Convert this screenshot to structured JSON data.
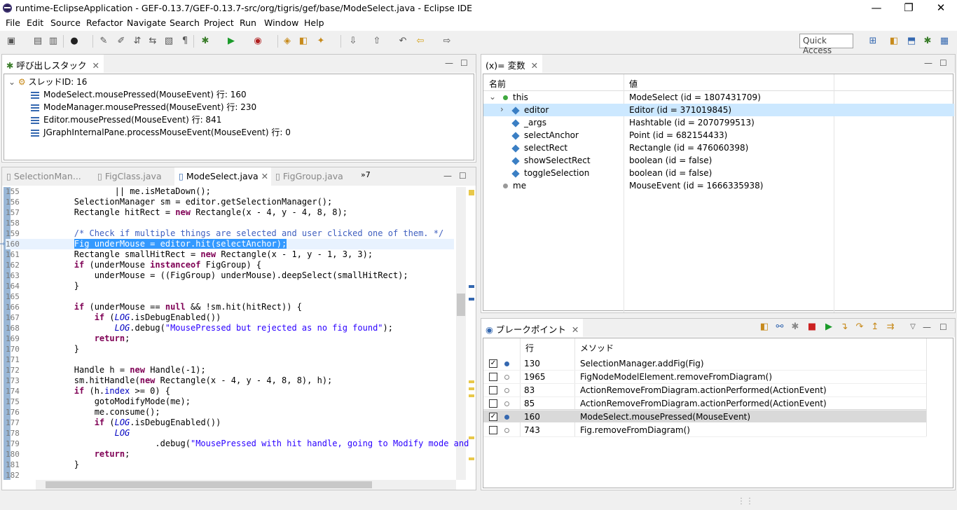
{
  "window": {
    "title": "runtime-EclipseApplication - GEF-0.13.7/GEF-0.13.7-src/org/tigris/gef/base/ModeSelect.java - Eclipse IDE",
    "minimize": "—",
    "restore": "❐",
    "close": "✕"
  },
  "menu": [
    {
      "label": "File"
    },
    {
      "label": "Edit"
    },
    {
      "label": "Source"
    },
    {
      "label": "Refactor"
    },
    {
      "label": "Navigate"
    },
    {
      "label": "Search"
    },
    {
      "label": "Project"
    },
    {
      "label": "Run"
    },
    {
      "label": "Window"
    },
    {
      "label": "Help"
    }
  ],
  "toolbar": {
    "quick_access": "Quick Access"
  },
  "callstack": {
    "tab": "呼び出しスタック",
    "thread": "スレッドID: 16",
    "frames": [
      "ModeSelect.mousePressed(MouseEvent) 行: 160",
      "ModeManager.mousePressed(MouseEvent) 行: 230",
      "Editor.mousePressed(MouseEvent) 行: 841",
      "JGraphInternalPane.processMouseEvent(MouseEvent) 行: 0"
    ]
  },
  "editor": {
    "tabs": [
      "SelectionMan...",
      "FigClass.java",
      "ModeSelect.java",
      "FigGroup.java"
    ],
    "overflow": "»7",
    "active_tab": 2
  },
  "variables": {
    "tab": "(x)= 変数",
    "col_name": "名前",
    "col_value": "値",
    "rows": [
      {
        "name": "this",
        "value": "ModeSelect (id = 1807431709)"
      },
      {
        "name": "editor",
        "value": "Editor (id = 371019845)"
      },
      {
        "name": "_args",
        "value": "Hashtable (id = 2070799513)"
      },
      {
        "name": "selectAnchor",
        "value": "Point (id = 682154433)"
      },
      {
        "name": "selectRect",
        "value": "Rectangle (id = 476060398)"
      },
      {
        "name": "showSelectRect",
        "value": "boolean (id = false)"
      },
      {
        "name": "toggleSelection",
        "value": "boolean (id = false)"
      },
      {
        "name": "me",
        "value": "MouseEvent (id = 1666335938)"
      }
    ]
  },
  "breakpoints": {
    "tab": "ブレークポイント",
    "col_line": "行",
    "col_method": "メソッド",
    "rows": [
      {
        "line": "130",
        "method": "SelectionManager.addFig(Fig)",
        "checked": "✓"
      },
      {
        "line": "1965",
        "method": "FigNodeModelElement.removeFromDiagram()",
        "checked": ""
      },
      {
        "line": "83",
        "method": "ActionRemoveFromDiagram.actionPerformed(ActionEvent)",
        "checked": ""
      },
      {
        "line": "85",
        "method": "ActionRemoveFromDiagram.actionPerformed(ActionEvent)",
        "checked": ""
      },
      {
        "line": "160",
        "method": "ModeSelect.mousePressed(MouseEvent)",
        "checked": "✓"
      },
      {
        "line": "743",
        "method": "Fig.removeFromDiagram()",
        "checked": ""
      }
    ]
  },
  "code_lines": [
    {
      "n": "155",
      "t": "                || me.isMetaDown();"
    },
    {
      "n": "156",
      "t": "        SelectionManager sm = editor.getSelectionManager();"
    },
    {
      "n": "157",
      "t": "        Rectangle hitRect = new Rectangle(x - 4, y - 4, 8, 8);"
    },
    {
      "n": "158",
      "t": ""
    },
    {
      "n": "159",
      "t": "        /* Check if multiple things are selected and user clicked one of them. */"
    },
    {
      "n": "160",
      "t": "        Fig underMouse = editor.hit(selectAnchor);"
    },
    {
      "n": "161",
      "t": "        Rectangle smallHitRect = new Rectangle(x - 1, y - 1, 3, 3);"
    },
    {
      "n": "162",
      "t": "        if (underMouse instanceof FigGroup) {"
    },
    {
      "n": "163",
      "t": "            underMouse = ((FigGroup) underMouse).deepSelect(smallHitRect);"
    },
    {
      "n": "164",
      "t": "        }"
    },
    {
      "n": "165",
      "t": ""
    },
    {
      "n": "166",
      "t": "        if (underMouse == null && !sm.hit(hitRect)) {"
    },
    {
      "n": "167",
      "t": "            if (LOG.isDebugEnabled())"
    },
    {
      "n": "168",
      "t": "                LOG.debug(\"MousePressed but rejected as no fig found\");"
    },
    {
      "n": "169",
      "t": "            return;"
    },
    {
      "n": "170",
      "t": "        }"
    },
    {
      "n": "171",
      "t": ""
    },
    {
      "n": "172",
      "t": "        Handle h = new Handle(-1);"
    },
    {
      "n": "173",
      "t": "        sm.hitHandle(new Rectangle(x - 4, y - 4, 8, 8), h);"
    },
    {
      "n": "174",
      "t": "        if (h.index >= 0) {"
    },
    {
      "n": "175",
      "t": "            gotoModifyMode(me);"
    },
    {
      "n": "176",
      "t": "            me.consume();"
    },
    {
      "n": "177",
      "t": "            if (LOG.isDebugEnabled())"
    },
    {
      "n": "178",
      "t": "                LOG"
    },
    {
      "n": "179",
      "t": "                        .debug(\"MousePressed with hit handle, going to Modify mode and"
    },
    {
      "n": "180",
      "t": "            return;"
    },
    {
      "n": "181",
      "t": "        }"
    },
    {
      "n": "182",
      "t": ""
    }
  ]
}
